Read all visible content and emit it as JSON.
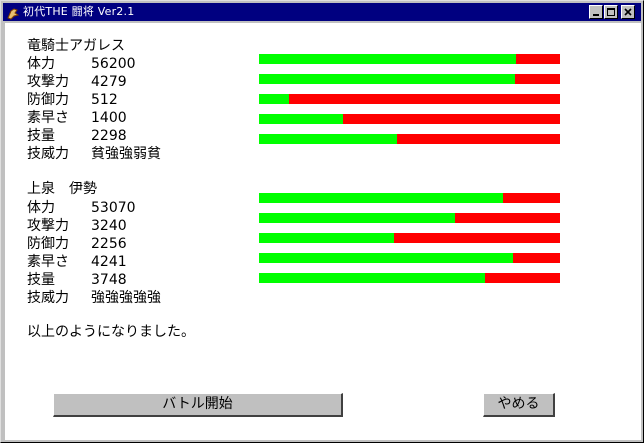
{
  "window": {
    "title": "初代THE 闘将 Ver2.1"
  },
  "fighter1": {
    "name": "竜騎士アガレス",
    "stats": [
      {
        "label": "体力",
        "value": "56200",
        "ratio": 0.855
      },
      {
        "label": "攻撃力",
        "value": "4279",
        "ratio": 0.852
      },
      {
        "label": "防御力",
        "value": "512",
        "ratio": 0.1
      },
      {
        "label": "素早さ",
        "value": "1400",
        "ratio": 0.28
      },
      {
        "label": "技量",
        "value": "2298",
        "ratio": 0.46
      }
    ],
    "skill_label": "技威力",
    "skill_value": "貧強強弱貧"
  },
  "fighter2": {
    "name": "上泉　伊勢",
    "stats": [
      {
        "label": "体力",
        "value": "53070",
        "ratio": 0.81
      },
      {
        "label": "攻撃力",
        "value": "3240",
        "ratio": 0.65
      },
      {
        "label": "防御力",
        "value": "2256",
        "ratio": 0.45
      },
      {
        "label": "素早さ",
        "value": "4241",
        "ratio": 0.845
      },
      {
        "label": "技量",
        "value": "3748",
        "ratio": 0.75
      }
    ],
    "skill_label": "技威力",
    "skill_value": "強強強強強"
  },
  "message": "以上のようになりました。",
  "buttons": {
    "start": "バトル開始",
    "quit": "やめる"
  },
  "colors": {
    "bar_fill": "#00ff00",
    "bar_empty": "#ff0000",
    "titlebar": "#000080"
  }
}
